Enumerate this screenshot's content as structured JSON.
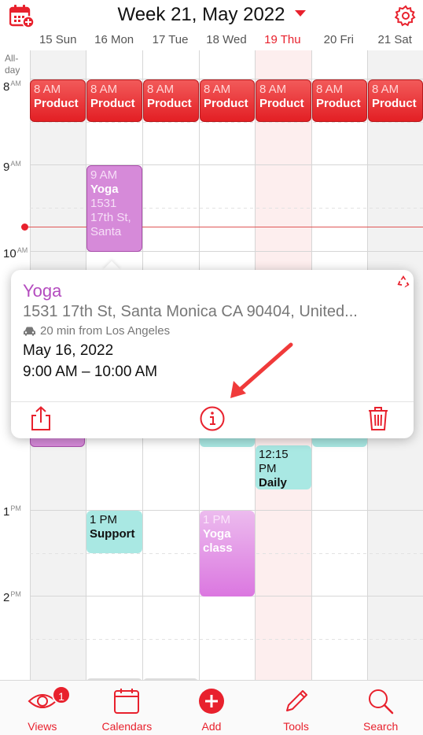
{
  "header": {
    "title": "Week 21, May 2022",
    "days": [
      "15 Sun",
      "16 Mon",
      "17 Tue",
      "18 Wed",
      "19 Thu",
      "20 Fri",
      "21 Sat"
    ],
    "today_index": 4
  },
  "grid": {
    "allday_label": "All-\nday",
    "hours": [
      {
        "num": "8",
        "suffix": "AM"
      },
      {
        "num": "9",
        "suffix": "AM"
      },
      {
        "num": "10",
        "suffix": "AM"
      },
      {
        "num": "1",
        "suffix": "PM"
      },
      {
        "num": "2",
        "suffix": "PM"
      }
    ]
  },
  "events": {
    "product_time": "8 AM",
    "product_name": "Product",
    "yoga_time": "9 AM",
    "yoga_name": "Yoga",
    "yoga_addr": "1531 17th St, Santa",
    "daily_time": "12:15 PM",
    "daily_name": "Daily",
    "support_time": "1 PM",
    "support_name": "Support",
    "yogaclass_time": "1 PM",
    "yogaclass_name": "Yoga class"
  },
  "popup": {
    "title": "Yoga",
    "address": "1531 17th St, Santa Monica CA 90404, United...",
    "travel": "20 min from Los Angeles",
    "date": "May 16, 2022",
    "time": "9:00 AM – 10:00 AM"
  },
  "tabbar": {
    "items": [
      "Views",
      "Calendars",
      "Add",
      "Tools",
      "Search"
    ],
    "views_badge": "1"
  },
  "colors": {
    "accent": "#e8212d",
    "event_red": "#e31f24",
    "event_purple": "#d68ad9",
    "event_teal": "#a9e8e3",
    "popup_title": "#b44cbf"
  },
  "icons": [
    "calendar-add-icon",
    "settings-gear-icon",
    "recycle-icon",
    "car-icon",
    "share-icon",
    "info-icon",
    "trash-icon",
    "eye-icon",
    "calendar-icon",
    "plus-circle-icon",
    "pencil-icon",
    "search-icon"
  ]
}
